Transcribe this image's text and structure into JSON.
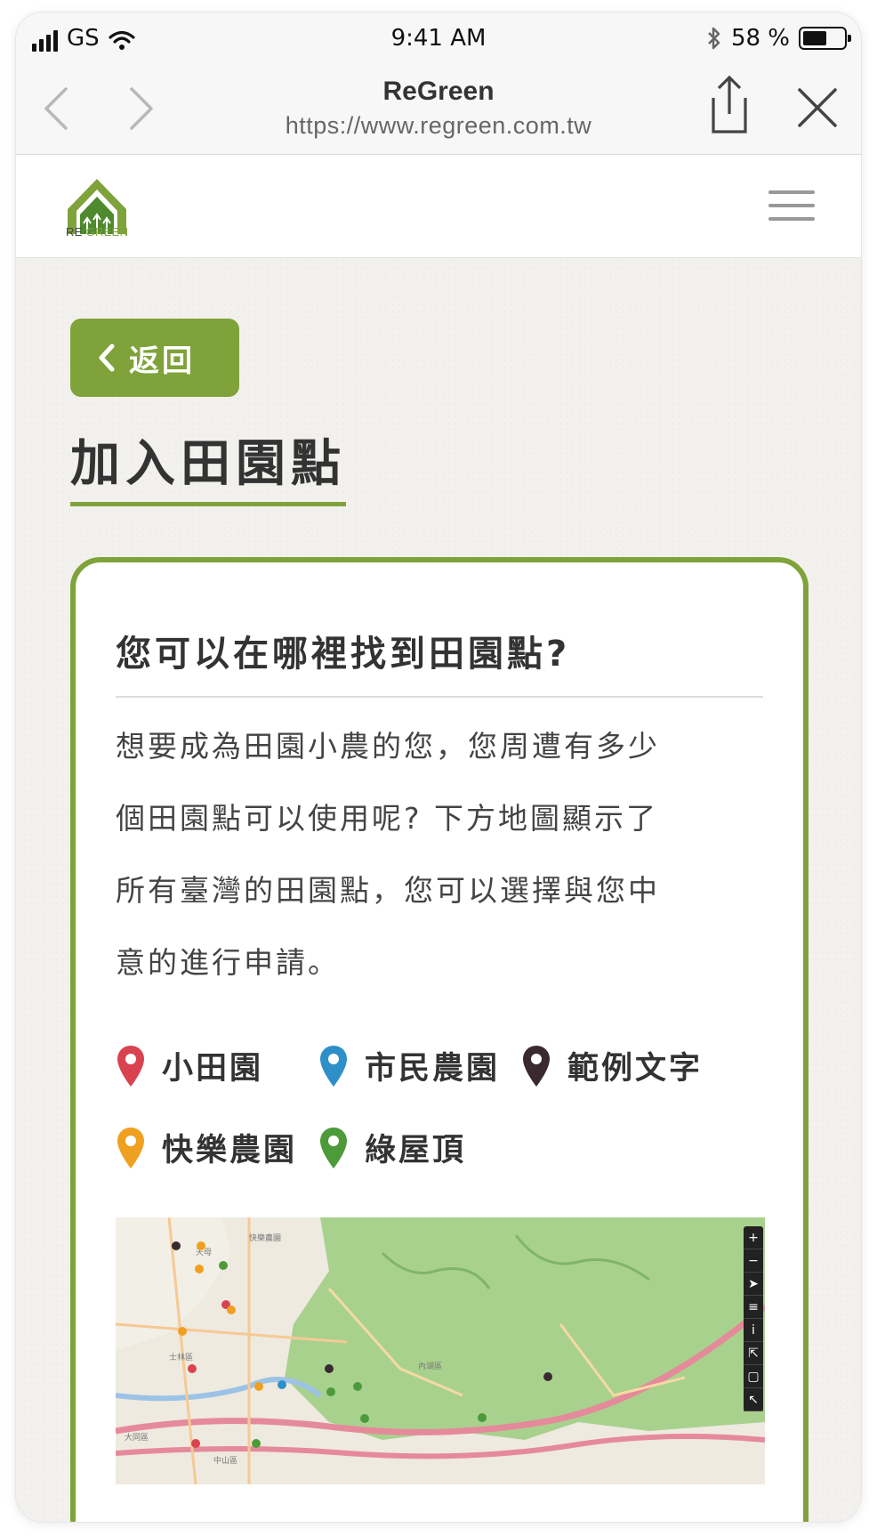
{
  "status_bar": {
    "carrier": "GS",
    "time": "9:41 AM",
    "battery": "58 %",
    "battery_level": 0.58
  },
  "browser": {
    "title": "ReGreen",
    "url": "https://www.regreen.com.tw"
  },
  "site": {
    "logo_re": "RE",
    "logo_green": "GREEN",
    "brand_color": "#7fa33a"
  },
  "page": {
    "back_label": "返回",
    "title": "加入田園點"
  },
  "card": {
    "title": "您可以在哪裡找到田園點?",
    "body_lines": [
      "想要成為田園小農的您，您周遭有多少",
      "個田園點可以使用呢? 下方地圖顯示了",
      "所有臺灣的田園點，您可以選擇與您中",
      "意的進行申請。"
    ]
  },
  "legend": [
    {
      "label": "小田園",
      "color": "#d9424f"
    },
    {
      "label": "市民農園",
      "color": "#2f8fc9"
    },
    {
      "label": "範例文字",
      "color": "#3a2a30"
    },
    {
      "label": "快樂農園",
      "color": "#f0a020"
    },
    {
      "label": "綠屋頂",
      "color": "#4c9a3a"
    }
  ],
  "map": {
    "labels": {
      "a": "快樂農園",
      "b": "士林區",
      "c": "內湖區",
      "d": "大同區",
      "e": "中山區",
      "f": "天母"
    },
    "controls": [
      "+",
      "−",
      "➤",
      "≡",
      "i",
      "⇱",
      "▢",
      "↖"
    ]
  }
}
